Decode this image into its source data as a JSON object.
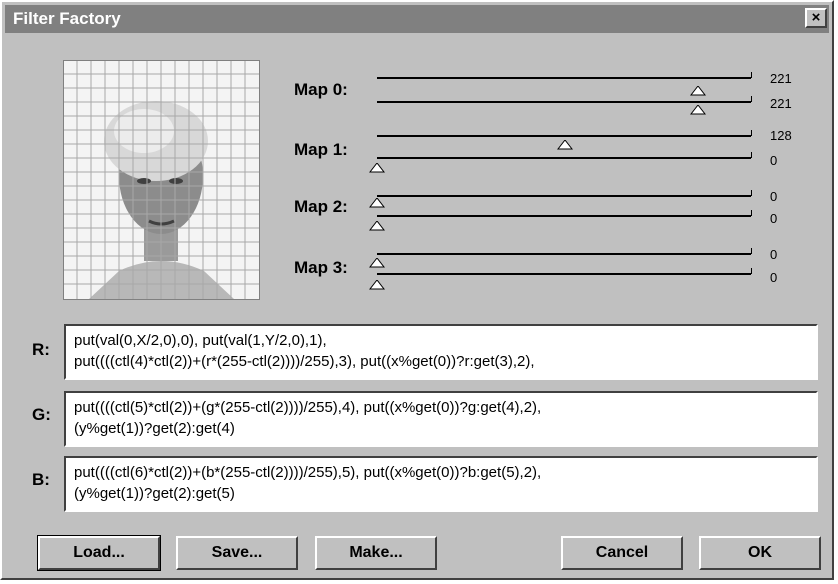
{
  "window": {
    "title": "Filter Factory",
    "close_glyph": "×"
  },
  "preview": {
    "description_icon": "portrait-preview"
  },
  "maps": [
    {
      "label": "Map 0:",
      "sliders": [
        {
          "value": "221"
        },
        {
          "value": "221"
        }
      ]
    },
    {
      "label": "Map 1:",
      "sliders": [
        {
          "value": "128"
        },
        {
          "value": "0"
        }
      ]
    },
    {
      "label": "Map 2:",
      "sliders": [
        {
          "value": "0"
        },
        {
          "value": "0"
        }
      ]
    },
    {
      "label": "Map 3:",
      "sliders": [
        {
          "value": "0"
        },
        {
          "value": "0"
        }
      ]
    }
  ],
  "channels": [
    {
      "label": "R:",
      "lines": [
        "put(val(0,X/2,0),0), put(val(1,Y/2,0),1),",
        "put((((ctl(4)*ctl(2))+(r*(255-ctl(2))))/255),3), put((x%get(0))?r:get(3),2),"
      ]
    },
    {
      "label": "G:",
      "lines": [
        "put((((ctl(5)*ctl(2))+(g*(255-ctl(2))))/255),4), put((x%get(0))?g:get(4),2),",
        "(y%get(1))?get(2):get(4)"
      ]
    },
    {
      "label": "B:",
      "lines": [
        "put((((ctl(6)*ctl(2))+(b*(255-ctl(2))))/255),5), put((x%get(0))?b:get(5),2),",
        "(y%get(1))?get(2):get(5)"
      ]
    }
  ],
  "buttons": {
    "load": "Load...",
    "save": "Save...",
    "make": "Make...",
    "cancel": "Cancel",
    "ok": "OK"
  }
}
